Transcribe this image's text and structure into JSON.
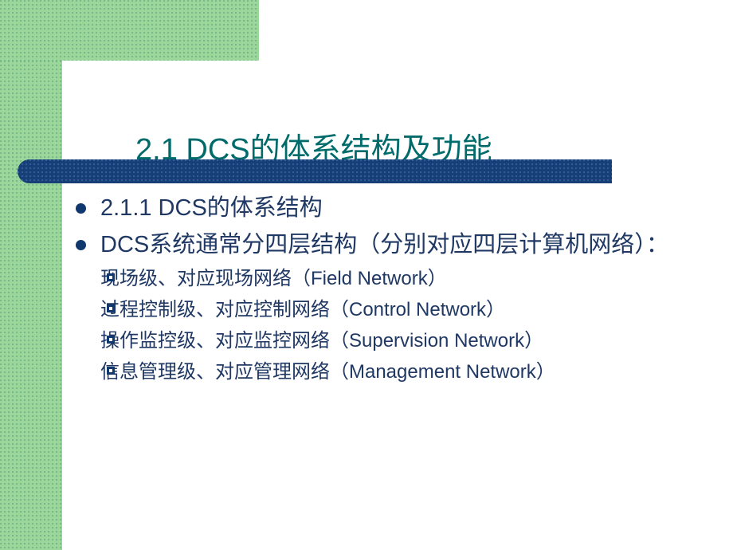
{
  "slide": {
    "title": "2.1 DCS的体系结构及功能",
    "theme": {
      "green": "#9BD79B",
      "title_teal": "#006B6B",
      "bar_navy": "#173E76",
      "text_navy": "#1F3864",
      "bullet_navy": "#11386E",
      "background": "#FFFFFF"
    },
    "bullets": [
      {
        "marker": "round-bullet",
        "text": "2.1.1 DCS的体系结构",
        "children": []
      },
      {
        "marker": "round-bullet",
        "text": "DCS系统通常分四层结构（分别对应四层计算机网络）：",
        "children": [
          {
            "marker": "square-bullet",
            "text": "现场级、对应现场网络（Field Network）"
          },
          {
            "marker": "square-bullet",
            "text": "过程控制级、对应控制网络（Control Network）"
          },
          {
            "marker": "square-bullet",
            "text": "操作监控级、对应监控网络（Supervision Network）"
          },
          {
            "marker": "square-bullet",
            "text": "信息管理级、对应管理网络（Management Network）"
          }
        ]
      }
    ]
  }
}
